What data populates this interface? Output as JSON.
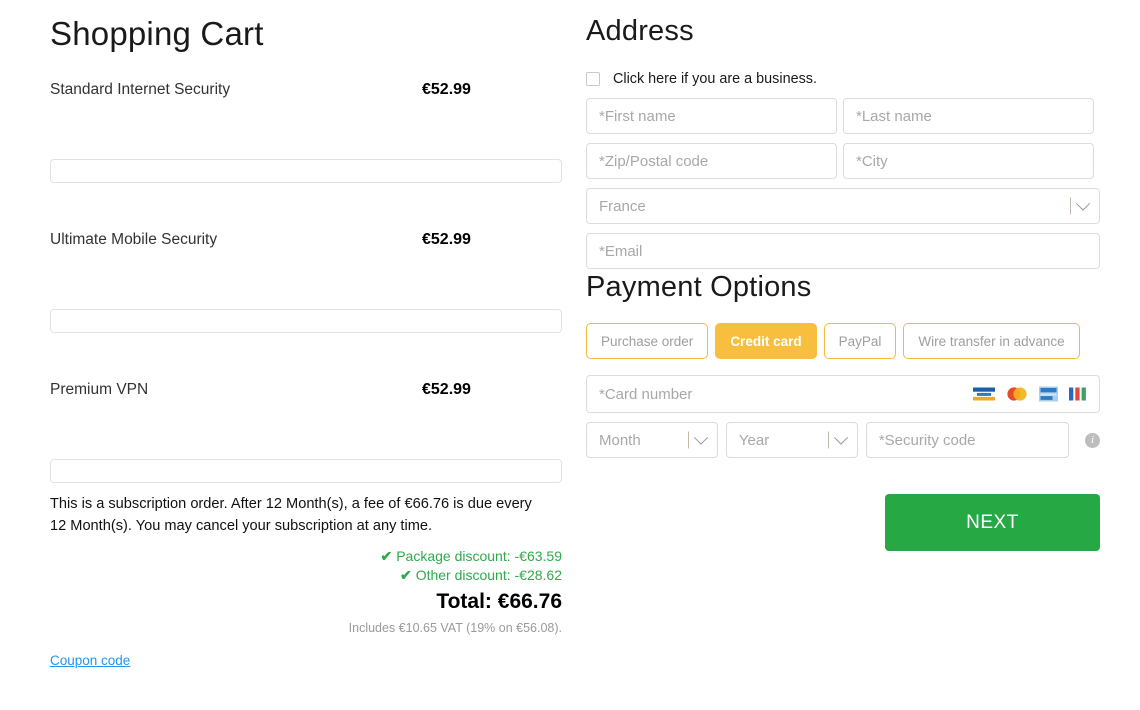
{
  "cart": {
    "title": "Shopping Cart",
    "items": [
      {
        "name": "Standard Internet Security",
        "price": "€52.99"
      },
      {
        "name": "Ultimate Mobile Security",
        "price": "€52.99"
      },
      {
        "name": "Premium VPN",
        "price": "€52.99"
      }
    ],
    "subscription_note": "This is a subscription order. After 12 Month(s), a fee of €66.76 is due every 12 Month(s). You may cancel your subscription at any time.",
    "discounts": [
      {
        "label": "Package discount:",
        "amount": "-€63.59"
      },
      {
        "label": "Other discount:",
        "amount": "-€28.62"
      }
    ],
    "total_label": "Total:",
    "total_value": "€66.76",
    "vat_note": "Includes €10.65 VAT (19% on €56.08).",
    "coupon_link": "Coupon code",
    "check_glyph": "✔"
  },
  "address": {
    "title": "Address",
    "business_checkbox_label": "Click here if you are a business.",
    "first_name_placeholder": "*First name",
    "last_name_placeholder": "*Last name",
    "zip_placeholder": "*Zip/Postal code",
    "city_placeholder": "*City",
    "country_value": "France",
    "email_placeholder": "*Email"
  },
  "payment": {
    "title": "Payment Options",
    "tabs": [
      {
        "label": "Purchase order",
        "active": false
      },
      {
        "label": "Credit card",
        "active": true
      },
      {
        "label": "PayPal",
        "active": false
      },
      {
        "label": "Wire transfer in advance",
        "active": false
      }
    ],
    "card_number_placeholder": "*Card number",
    "month_placeholder": "Month",
    "year_placeholder": "Year",
    "security_code_placeholder": "*Security code",
    "card_brands": [
      "visa-card-icon",
      "mastercard-card-icon",
      "maestro-card-icon",
      "jcb-card-icon"
    ],
    "info_glyph": "i"
  },
  "actions": {
    "next_label": "NEXT"
  },
  "colors": {
    "accent_amber": "#f8bf3e",
    "next_green": "#26a844",
    "discount_green": "#2eaa4a",
    "link_blue": "#2196f3",
    "placeholder_gray": "#a8a8a8"
  }
}
